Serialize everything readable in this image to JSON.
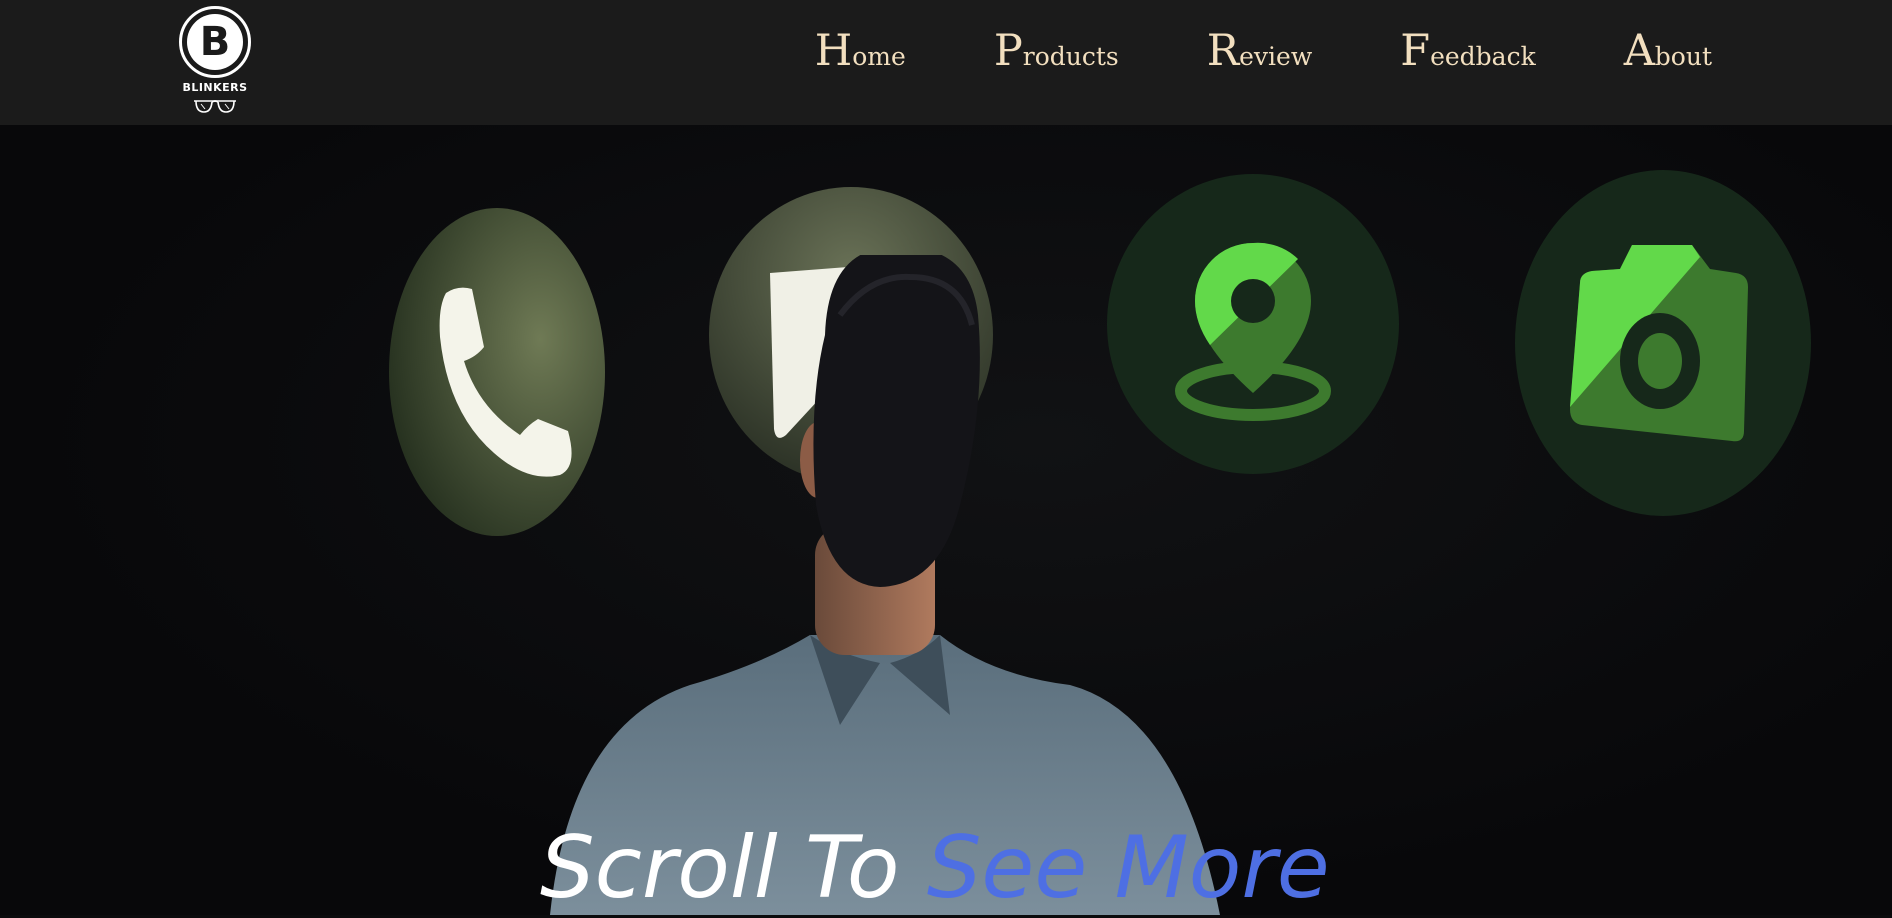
{
  "brand": {
    "logo_letter": "B",
    "name": "BLINKERS"
  },
  "nav": {
    "items": [
      {
        "cap": "H",
        "rest": "ome"
      },
      {
        "cap": "P",
        "rest": "roducts"
      },
      {
        "cap": "R",
        "rest": "eview"
      },
      {
        "cap": "F",
        "rest": "eedback"
      },
      {
        "cap": "A",
        "rest": "bout"
      }
    ]
  },
  "hero": {
    "heading_part1": "Scroll To ",
    "heading_part2": "See More",
    "icons": [
      "phone-icon",
      "play-icon",
      "location-pin-icon",
      "camera-icon"
    ]
  },
  "colors": {
    "navbar_bg": "#1b1b1b",
    "nav_text": "#f2dfbf",
    "accent_blue": "#4e6fe3",
    "icon_green": "#62d94a",
    "icon_dark_green": "#3d7a2e"
  }
}
